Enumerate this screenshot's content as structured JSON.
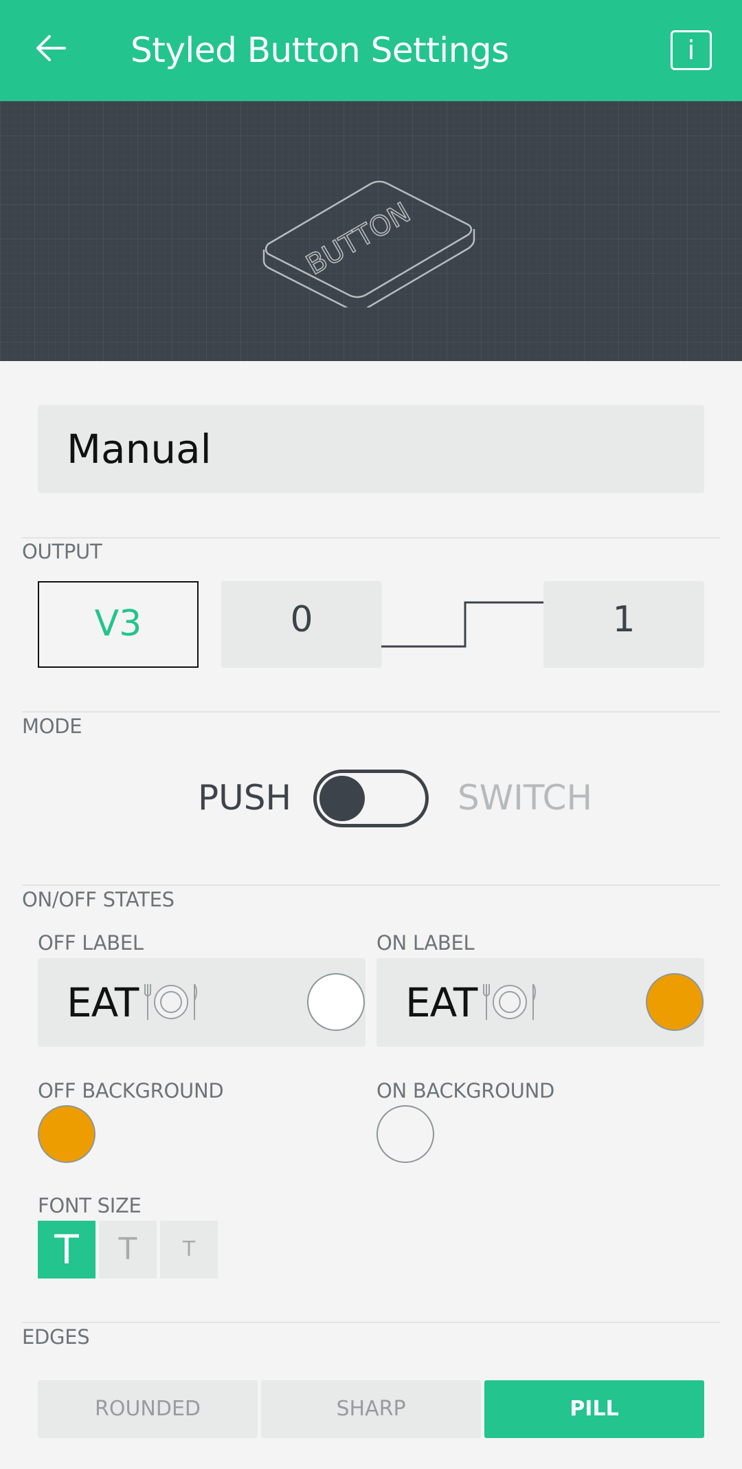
{
  "appbar": {
    "title": "Styled Button Settings",
    "info_label": "i"
  },
  "preview": {
    "button_text": "BUTTON"
  },
  "name_field": {
    "value": "Manual"
  },
  "output": {
    "section_label": "OUTPUT",
    "pin": "V3",
    "low_value": "0",
    "high_value": "1"
  },
  "mode": {
    "section_label": "MODE",
    "push_label": "PUSH",
    "switch_label": "SWITCH",
    "selected": "PUSH"
  },
  "states": {
    "section_label": "ON/OFF STATES",
    "off_label_caption": "OFF LABEL",
    "off_label_value": "EAT",
    "off_label_color": "#ffffff",
    "on_label_caption": "ON LABEL",
    "on_label_value": "EAT",
    "on_label_color": "#ed9d00",
    "off_background_caption": "OFF BACKGROUND",
    "off_background_color": "#ed9d00",
    "on_background_caption": "ON BACKGROUND",
    "on_background_color": "#f4f4f4",
    "emoji_icon": "plate-with-cutlery-icon"
  },
  "font_size": {
    "caption": "FONT SIZE",
    "options": [
      "T",
      "T",
      "T"
    ],
    "selected_index": 0
  },
  "edges": {
    "section_label": "EDGES",
    "options": [
      "ROUNDED",
      "SHARP",
      "PILL"
    ],
    "selected": "PILL"
  },
  "colors": {
    "accent": "#23c48e",
    "dark": "#3d434a",
    "orange": "#ed9d00"
  }
}
